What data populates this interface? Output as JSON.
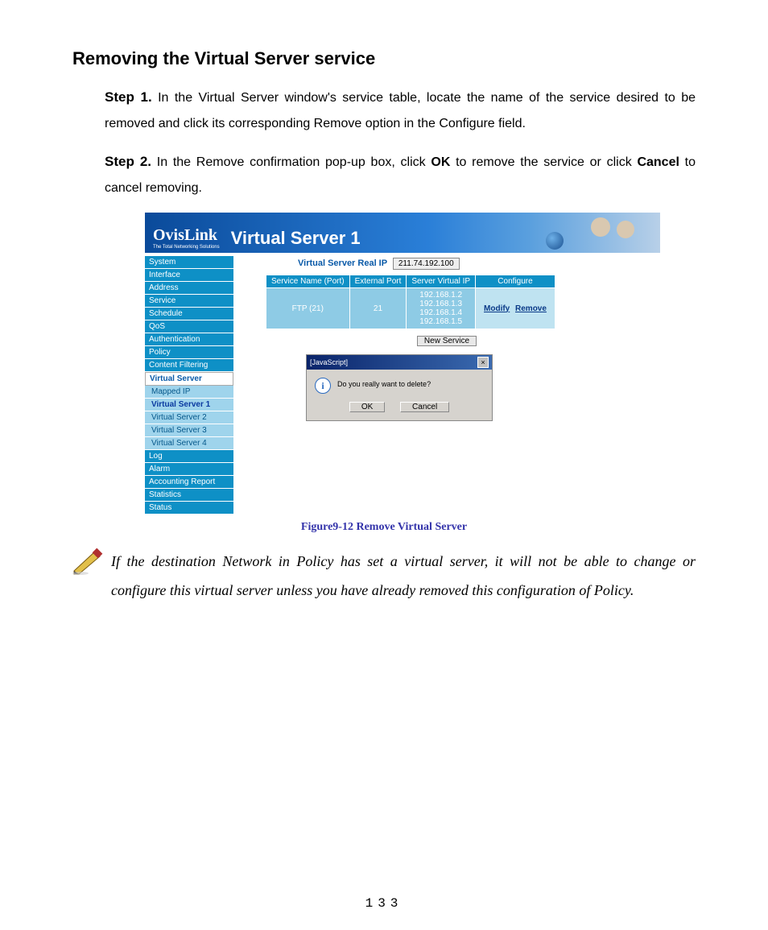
{
  "heading": "Removing the Virtual Server service",
  "steps": [
    {
      "label": "Step 1.",
      "text_parts": [
        "In the Virtual Server window's service table, locate the name of the service desired to be removed and click its corresponding Remove option in the Configure field."
      ]
    },
    {
      "label": "Step 2.",
      "text_parts_a": "In the Remove confirmation pop-up box, click ",
      "ok": "OK",
      "text_parts_b": " to remove the service or click ",
      "cancel": "Cancel",
      "text_parts_c": " to cancel removing."
    }
  ],
  "banner": {
    "brand": "OvisLink",
    "tagline": "The Total Networking Solutions",
    "title": "Virtual Server 1"
  },
  "sidebar": {
    "items": [
      "System",
      "Interface",
      "Address",
      "Service",
      "Schedule",
      "QoS",
      "Authentication",
      "Policy",
      "Content Filtering"
    ],
    "vs_group": "Virtual Server",
    "subs": [
      "Mapped IP",
      "Virtual Server 1",
      "Virtual Server 2",
      "Virtual Server 3",
      "Virtual Server 4"
    ],
    "items2": [
      "Log",
      "Alarm",
      "Accounting Report",
      "Statistics",
      "Status"
    ]
  },
  "realip": {
    "label": "Virtual Server Real IP",
    "value": "211.74.192.100"
  },
  "table": {
    "headers": [
      "Service Name (Port)",
      "External Port",
      "Server Virtual IP",
      "Configure"
    ],
    "row": {
      "service": "FTP (21)",
      "ext_port": "21",
      "vips": [
        "192.168.1.2",
        "192.168.1.3",
        "192.168.1.4",
        "192.168.1.5"
      ],
      "modify": "Modify",
      "remove": "Remove"
    }
  },
  "new_service_btn": "New Service",
  "dialog": {
    "title": "[JavaScript]",
    "message": "Do you really want to delete?",
    "ok": "OK",
    "cancel": "Cancel"
  },
  "figure_caption": "Figure9-12    Remove Virtual Server",
  "note": "If the destination Network in Policy has set a virtual server, it will not be able to change or configure this virtual server unless you have already removed this configuration of Policy.",
  "page_number": "133"
}
